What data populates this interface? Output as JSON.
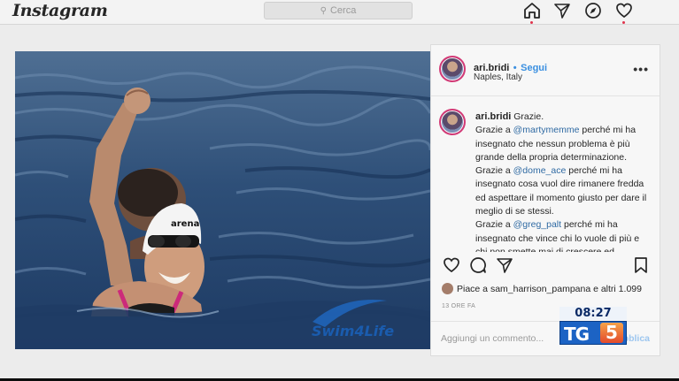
{
  "header": {
    "logo": "Instagram",
    "search": {
      "placeholder": "Cerca"
    },
    "nav_icons": [
      "home-icon",
      "direct-icon",
      "explore-icon",
      "heart-icon"
    ]
  },
  "post": {
    "username": "ari.bridi",
    "separator": "•",
    "follow": "Segui",
    "location": "Naples, Italy",
    "more": "•••",
    "caption_intro": "Grazie.",
    "caption_lines": [
      {
        "pre": "Grazie a ",
        "mention": "@martymemme",
        "post": " perché mi ha insegnato che nessun problema è più grande della propria determinazione."
      },
      {
        "pre": "Grazie a ",
        "mention": "@dome_ace",
        "post": " perché mi ha insegnato cosa vuol dire rimanere fredda ed aspettare il momento giusto per dare il meglio di se stessi."
      },
      {
        "pre": "Grazie a ",
        "mention": "@greg_palt",
        "post": " perché mi ha insegnato che vince chi lo vuole di più e chi non smette mai di crescere ed"
      }
    ],
    "likes_text": "Piace a sam_harrison_pampana e altri 1.099",
    "time": "13 ORE FA",
    "comment_placeholder": "Aggiungi un commento...",
    "publish": "Pubblica",
    "photo_watermark": "Swim4Life"
  },
  "overlay": {
    "clock": "08:27",
    "channel": "TG",
    "channel_number": "5"
  },
  "colors": {
    "accent": "#3a8fe0",
    "mention": "#2f6aa3",
    "notification": "#e0334c"
  }
}
